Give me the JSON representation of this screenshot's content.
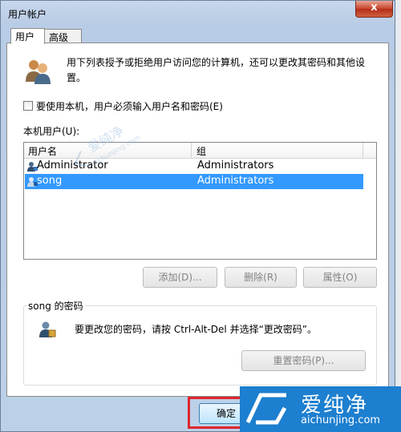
{
  "window": {
    "title": "用户帐户",
    "close_label": "x"
  },
  "tabs": [
    {
      "label": "用户"
    },
    {
      "label": "高级"
    }
  ],
  "description": "用下列表授予或拒绝用户访问您的计算机，还可以更改其密码和其他设置。",
  "require_login_checkbox": {
    "label": "要使用本机，用户必须输入用户名和密码(E)",
    "checked": false
  },
  "users_list": {
    "label": "本机用户(U):",
    "columns": [
      "用户名",
      "组"
    ],
    "rows": [
      {
        "name": "Administrator",
        "group": "Administrators",
        "selected": false
      },
      {
        "name": "song",
        "group": "Administrators",
        "selected": true
      }
    ]
  },
  "buttons": {
    "add": "添加(D)...",
    "remove": "删除(R)",
    "properties": "属性(O)"
  },
  "password_group": {
    "title": "song 的密码",
    "description": "要更改您的密码，请按 Ctrl-Alt-Del 并选择“更改密码”。",
    "reset_button": "重置密码(P)..."
  },
  "footer": {
    "ok_label": "确定"
  },
  "watermark": {
    "brand": "爱纯净",
    "url": "aichunjing.com",
    "faint_brand": "爱纯净",
    "faint_url": "aichunjing.com"
  },
  "colors": {
    "selection": "#3399ff",
    "highlight_box": "#e0262b",
    "watermark_bg": "#1d7fcf"
  }
}
